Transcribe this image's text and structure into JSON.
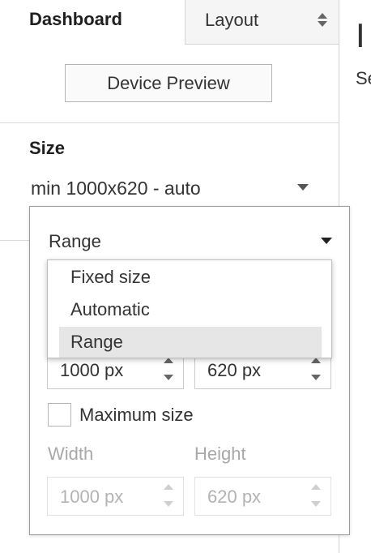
{
  "tabs": {
    "dashboard": "Dashboard",
    "layout": "Layout"
  },
  "right_pane": {
    "title_partial": "I",
    "subtitle_partial": "Se"
  },
  "device_preview_label": "Device Preview",
  "size": {
    "heading": "Size",
    "value": "min 1000x620 - auto"
  },
  "popup": {
    "mode_selected": "Range",
    "mode_options": [
      "Fixed size",
      "Automatic",
      "Range"
    ],
    "min_width": "1000 px",
    "min_height": "620 px",
    "maximum_size_label": "Maximum size",
    "maximum_size_checked": false,
    "width_label": "Width",
    "height_label": "Height",
    "max_width": "1000 px",
    "max_height": "620 px"
  }
}
